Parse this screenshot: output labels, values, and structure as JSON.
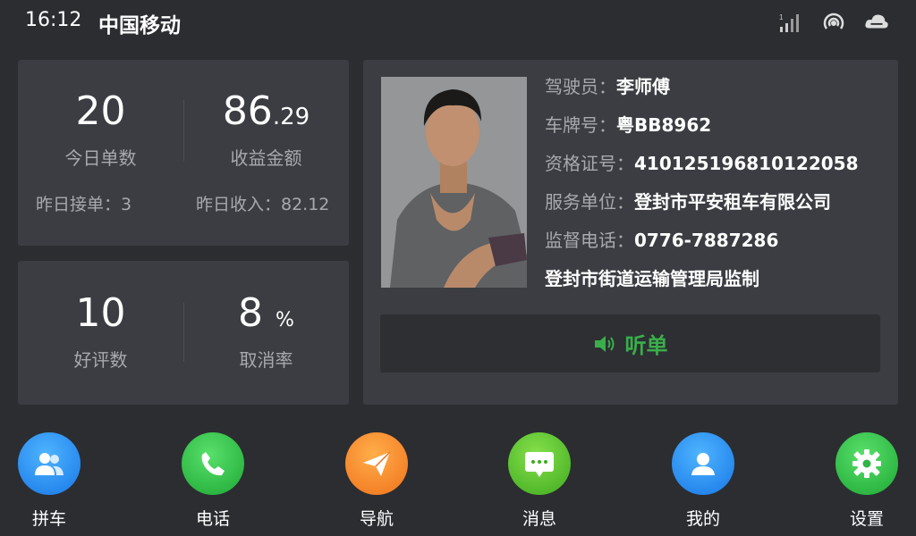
{
  "status_bar": {
    "time": "16:12",
    "carrier": "中国移动",
    "icons": [
      "signal-icon",
      "hotspot-icon",
      "cloud-icon"
    ]
  },
  "stats_today": {
    "orders_value": "20",
    "orders_label": "今日单数",
    "income_int": "86",
    "income_dec": ".29",
    "income_label": "收益金额",
    "yesterday_orders": "昨日接单：3",
    "yesterday_income": "昨日收入：82.12"
  },
  "stats_rating": {
    "good_reviews_value": "10",
    "good_reviews_label": "好评数",
    "cancel_rate_value": "8",
    "cancel_rate_unit": "%",
    "cancel_rate_label": "取消率"
  },
  "driver": {
    "driver_key": "驾驶员：",
    "driver_val": "李师傅",
    "plate_key": "车牌号：",
    "plate_val": "粤BB8962",
    "license_key": "资格证号：",
    "license_val": "410125196810122058",
    "company_key": "服务单位：",
    "company_val": "登封市平安租车有限公司",
    "phone_key": "监督电话：",
    "phone_val": "0776-7887286",
    "supervisor": "登封市街道运输管理局监制",
    "listen_label": "听单"
  },
  "dock": [
    {
      "label": "拼车",
      "icon": "carpool-icon"
    },
    {
      "label": "电话",
      "icon": "phone-icon"
    },
    {
      "label": "导航",
      "icon": "navigation-icon"
    },
    {
      "label": "消息",
      "icon": "message-icon"
    },
    {
      "label": "我的",
      "icon": "profile-icon"
    },
    {
      "label": "设置",
      "icon": "settings-icon"
    }
  ],
  "colors": {
    "background": "#2b2d31",
    "card": "#3b3d42",
    "accent_green": "#3aae4b",
    "muted_text": "#a7a9ad"
  }
}
